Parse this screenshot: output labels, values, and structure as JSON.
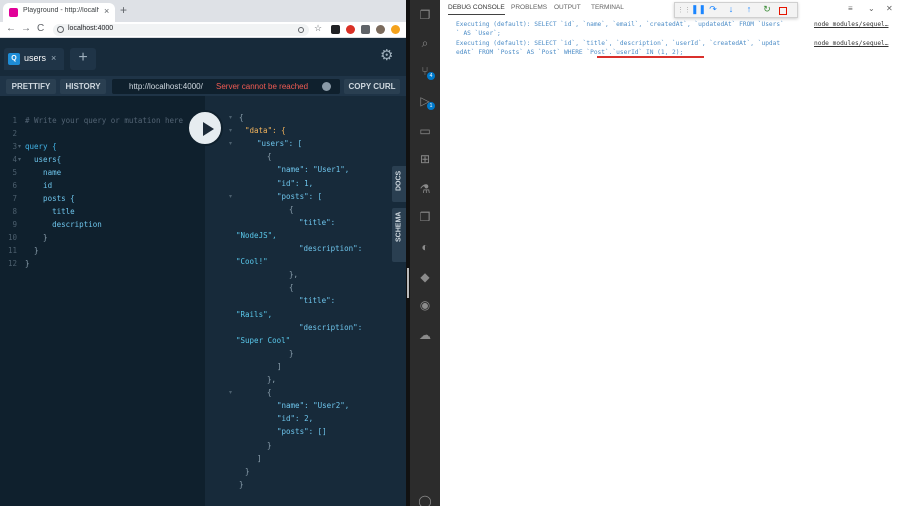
{
  "browser": {
    "tab_title": "Playground - http://localhost:4",
    "tab_close": "×",
    "new_tab": "+",
    "nav_back": "←",
    "nav_forward": "→",
    "nav_reload": "C",
    "url": "localhost:4000"
  },
  "playground": {
    "tab_badge": "Q",
    "tab_label": "users",
    "tab_close": "×",
    "add_tab": "+",
    "settings_icon": "⚙",
    "toolbar": {
      "prettify": "PRETTIFY",
      "history": "HISTORY",
      "endpoint": "http://localhost:4000/",
      "server_status": "Server cannot be reached",
      "copy_curl": "COPY CURL"
    },
    "query_lines": [
      {
        "n": "1",
        "text": "# Write your query or mutation here",
        "cls": "c-com",
        "fold": false
      },
      {
        "n": "2",
        "text": "",
        "cls": "c-kw",
        "fold": false
      },
      {
        "n": "3",
        "text": "query {",
        "cls": "c-kw",
        "fold": true
      },
      {
        "n": "4",
        "text": "  users{",
        "cls": "c-fld",
        "fold": true
      },
      {
        "n": "5",
        "text": "    name",
        "cls": "c-fld",
        "fold": false
      },
      {
        "n": "6",
        "text": "    id",
        "cls": "c-fld",
        "fold": false
      },
      {
        "n": "7",
        "text": "    posts {",
        "cls": "c-fld",
        "fold": false
      },
      {
        "n": "8",
        "text": "      title",
        "cls": "c-fld",
        "fold": false
      },
      {
        "n": "9",
        "text": "      description",
        "cls": "c-fld",
        "fold": false
      },
      {
        "n": "10",
        "text": "    }",
        "cls": "c-brace",
        "fold": false
      },
      {
        "n": "11",
        "text": "  }",
        "cls": "c-brace",
        "fold": false
      },
      {
        "n": "12",
        "text": "}",
        "cls": "c-brace",
        "fold": false
      }
    ],
    "result_lines": [
      {
        "x": 34,
        "text": "{",
        "cls": "c-brace",
        "fold": true
      },
      {
        "x": 40,
        "text": "\"data\": {",
        "cls": "c-key",
        "fold": true
      },
      {
        "x": 52,
        "text": "\"users\": [",
        "cls": "c-fld",
        "fold": true
      },
      {
        "x": 62,
        "text": "{",
        "cls": "c-brace",
        "fold": false
      },
      {
        "x": 72,
        "text": "\"name\": \"User1\",",
        "cls": "c-fld",
        "fold": false
      },
      {
        "x": 72,
        "text": "\"id\": 1,",
        "cls": "c-fld",
        "fold": false
      },
      {
        "x": 72,
        "text": "\"posts\": [",
        "cls": "c-fld",
        "fold": true
      },
      {
        "x": 84,
        "text": "{",
        "cls": "c-brace",
        "fold": false
      },
      {
        "x": 94,
        "text": "\"title\":",
        "cls": "c-fld",
        "fold": false
      },
      {
        "x": 31,
        "text": "\"NodeJS\",",
        "cls": "c-str",
        "fold": false
      },
      {
        "x": 94,
        "text": "\"description\":",
        "cls": "c-fld",
        "fold": false
      },
      {
        "x": 31,
        "text": "\"Cool!\"",
        "cls": "c-str",
        "fold": false
      },
      {
        "x": 84,
        "text": "},",
        "cls": "c-brace",
        "fold": false
      },
      {
        "x": 84,
        "text": "{",
        "cls": "c-brace",
        "fold": false
      },
      {
        "x": 94,
        "text": "\"title\":",
        "cls": "c-fld",
        "fold": false
      },
      {
        "x": 31,
        "text": "\"Rails\",",
        "cls": "c-str",
        "fold": false
      },
      {
        "x": 94,
        "text": "\"description\":",
        "cls": "c-fld",
        "fold": false
      },
      {
        "x": 31,
        "text": "\"Super Cool\"",
        "cls": "c-str",
        "fold": false
      },
      {
        "x": 84,
        "text": "}",
        "cls": "c-brace",
        "fold": false
      },
      {
        "x": 72,
        "text": "]",
        "cls": "c-brace",
        "fold": false
      },
      {
        "x": 62,
        "text": "},",
        "cls": "c-brace",
        "fold": false
      },
      {
        "x": 62,
        "text": "{",
        "cls": "c-brace",
        "fold": true
      },
      {
        "x": 72,
        "text": "\"name\": \"User2\",",
        "cls": "c-fld",
        "fold": false
      },
      {
        "x": 72,
        "text": "\"id\": 2,",
        "cls": "c-fld",
        "fold": false
      },
      {
        "x": 72,
        "text": "\"posts\": []",
        "cls": "c-fld",
        "fold": false
      },
      {
        "x": 62,
        "text": "}",
        "cls": "c-brace",
        "fold": false
      },
      {
        "x": 52,
        "text": "]",
        "cls": "c-brace",
        "fold": false
      },
      {
        "x": 40,
        "text": "}",
        "cls": "c-brace",
        "fold": false
      },
      {
        "x": 34,
        "text": "}",
        "cls": "c-brace",
        "fold": false
      }
    ],
    "side_docs": "DOCS",
    "side_schema": "SCHEMA"
  },
  "vscode": {
    "tabs": {
      "debug_console": "DEBUG CONSOLE",
      "problems": "PROBLEMS",
      "output": "OUTPUT",
      "terminal": "TERMINAL"
    },
    "console": [
      {
        "text": "Executing (default): SELECT `id`, `name`, `email`, `createdAt`, `updatedAt` FROM `Users`"
      },
      {
        "text": "` AS `User`;"
      },
      {
        "text": "Executing (default): SELECT `id`, `title`, `description`, `userId`, `createdAt`, `updat"
      },
      {
        "text": "edAt` FROM `Posts` AS `Post` WHERE `Post`.`userId` IN (1, 2);"
      }
    ],
    "source_link_1": "node_modules/sequel…",
    "source_link_2": "node_modules/sequel…"
  }
}
